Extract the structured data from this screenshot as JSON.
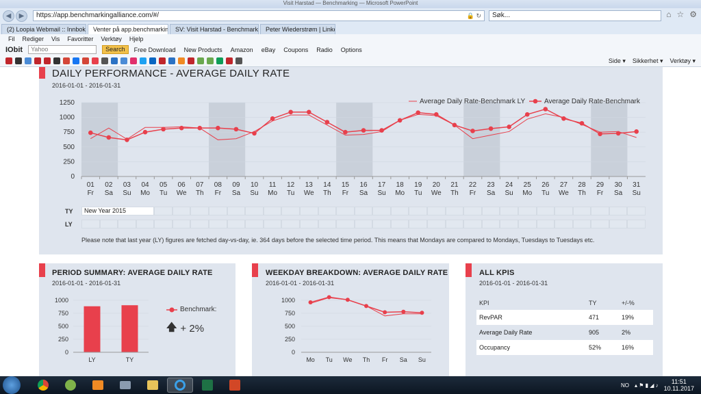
{
  "browser": {
    "title_strip": "Visit Harstad — Benchmarking — Microsoft PowerPoint",
    "url": "https://app.benchmarkingalliance.com/#/",
    "search_placeholder": "Søk...",
    "tabs": [
      {
        "label": "(2) Loopia Webmail :: Innboks",
        "color": "#c0262c",
        "active": false
      },
      {
        "label": "Venter på app.benchmarkin...",
        "color": "#e8404c",
        "active": true
      },
      {
        "label": "SV: Visit Harstad - Benchmarki...",
        "color": "#d44638",
        "active": false
      },
      {
        "label": "Peter Wiederstrøm | LinkedIn",
        "color": "#0a66c2",
        "active": false
      }
    ],
    "menu": [
      "Fil",
      "Rediger",
      "Vis",
      "Favoritter",
      "Verktøy",
      "Hjelp"
    ],
    "toolbar1": {
      "iobit": "IObit",
      "yahoo_placeholder": "Yahoo",
      "search_btn": "Search",
      "items": [
        "Free Download",
        "New Products",
        "Amazon",
        "eBay",
        "Coupons",
        "Radio",
        "Options"
      ]
    },
    "toolbar2_right": [
      "Side",
      "Sikkerhet",
      "Verktøy"
    ]
  },
  "daily": {
    "title": "DAILY PERFORMANCE - AVERAGE DAILY RATE",
    "date_range": "2016-01-01 - 2016-01-31",
    "legend_ly": "Average Daily Rate-Benchmark LY",
    "legend_ty": "Average Daily Rate-Benchmark",
    "ty_label": "TY",
    "ly_label": "LY",
    "ty_event": "New Year 2015",
    "note": "Please note that last year (LY) figures are fetched day-vs-day, ie. 364 days before the selected time period. This means that Mondays are compared to Mondays, Tuesdays to Tuesdays etc."
  },
  "period": {
    "title": "PERIOD SUMMARY: AVERAGE DAILY RATE",
    "date_range": "2016-01-01 - 2016-01-31",
    "legend": "Benchmark:",
    "change": "+ 2%"
  },
  "weekday": {
    "title": "WEEKDAY BREAKDOWN: AVERAGE DAILY RATE",
    "date_range": "2016-01-01 - 2016-01-31"
  },
  "kpis": {
    "title": "ALL KPIS",
    "date_range": "2016-01-01 - 2016-01-31",
    "headers": [
      "KPI",
      "TY",
      "+/-%"
    ],
    "rows": [
      {
        "kpi": "RevPAR",
        "ty": "471",
        "pct": "19%"
      },
      {
        "kpi": "Average Daily Rate",
        "ty": "905",
        "pct": "2%"
      },
      {
        "kpi": "Occupancy",
        "ty": "52%",
        "pct": "16%"
      }
    ]
  },
  "taskbar": {
    "lang": "NO",
    "time": "11:51",
    "date": "10.11.2017"
  },
  "colors": {
    "accent": "#e8404c",
    "panel": "#dfe5ee",
    "weekend": "#c9d0da"
  },
  "chart_data": [
    {
      "type": "line",
      "x": [
        "01",
        "02",
        "03",
        "04",
        "05",
        "06",
        "07",
        "08",
        "09",
        "10",
        "11",
        "12",
        "13",
        "14",
        "15",
        "16",
        "17",
        "18",
        "19",
        "20",
        "21",
        "22",
        "23",
        "24",
        "25",
        "26",
        "27",
        "28",
        "29",
        "30",
        "31"
      ],
      "x_days": [
        "Fr",
        "Sa",
        "Su",
        "Mo",
        "Tu",
        "We",
        "Th",
        "Fr",
        "Sa",
        "Su",
        "Mo",
        "Tu",
        "We",
        "Th",
        "Fr",
        "Sa",
        "Su",
        "Mo",
        "Tu",
        "We",
        "Th",
        "Fr",
        "Sa",
        "Su",
        "Mo",
        "Tu",
        "We",
        "Th",
        "Fr",
        "Sa",
        "Su"
      ],
      "weekend_bands": [
        [
          0,
          1
        ],
        [
          7,
          8
        ],
        [
          14,
          15
        ],
        [
          21,
          22
        ],
        [
          28,
          29
        ]
      ],
      "yticks": [
        0,
        250,
        500,
        750,
        1000,
        1250
      ],
      "ylim": [
        0,
        1250
      ],
      "series": [
        {
          "name": "Average Daily Rate-Benchmark LY",
          "values": [
            640,
            820,
            630,
            830,
            830,
            840,
            820,
            620,
            640,
            760,
            940,
            1040,
            1040,
            870,
            700,
            710,
            760,
            950,
            1050,
            1030,
            870,
            640,
            700,
            760,
            970,
            1060,
            1000,
            880,
            750,
            760,
            660
          ]
        },
        {
          "name": "Average Daily Rate-Benchmark",
          "values": [
            740,
            660,
            620,
            750,
            800,
            820,
            820,
            820,
            800,
            730,
            980,
            1090,
            1090,
            920,
            750,
            780,
            780,
            950,
            1080,
            1050,
            870,
            770,
            810,
            840,
            1050,
            1140,
            980,
            900,
            720,
            730,
            760
          ]
        }
      ]
    },
    {
      "type": "bar",
      "categories": [
        "LY",
        "TY"
      ],
      "values": [
        885,
        905
      ],
      "yticks": [
        0,
        250,
        500,
        750,
        1000
      ],
      "ylim": [
        0,
        1000
      ]
    },
    {
      "type": "line",
      "x": [
        "Mo",
        "Tu",
        "We",
        "Th",
        "Fr",
        "Sa",
        "Su"
      ],
      "yticks": [
        0,
        250,
        500,
        750,
        1000
      ],
      "ylim": [
        0,
        1000
      ],
      "series": [
        {
          "name": "LY",
          "values": [
            940,
            1050,
            1010,
            890,
            700,
            740,
            740
          ]
        },
        {
          "name": "TY",
          "values": [
            960,
            1060,
            1010,
            890,
            770,
            780,
            760
          ]
        }
      ]
    }
  ]
}
